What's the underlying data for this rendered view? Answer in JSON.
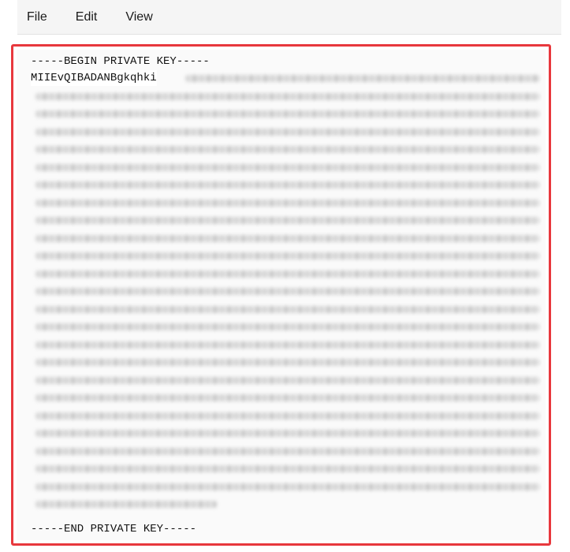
{
  "menu": {
    "items": [
      {
        "label": "File"
      },
      {
        "label": "Edit"
      },
      {
        "label": "View"
      }
    ]
  },
  "editor": {
    "begin_marker": "-----BEGIN PRIVATE KEY-----",
    "first_line_visible": "MIIEvQIBADANBgkqhki",
    "end_marker": "-----END PRIVATE KEY-----",
    "highlight_color": "#e8383d"
  }
}
